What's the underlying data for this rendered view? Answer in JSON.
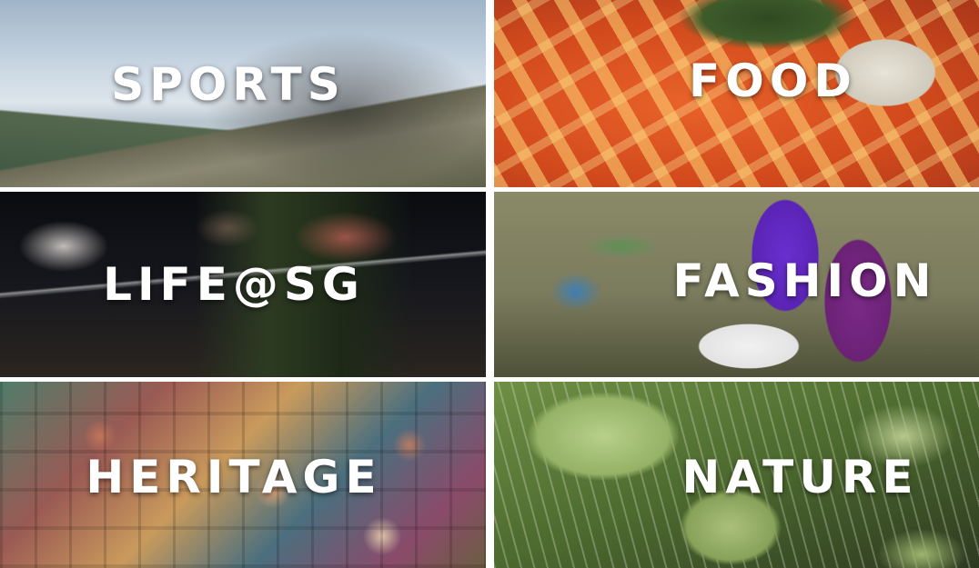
{
  "tiles": [
    {
      "id": "sports",
      "label": "SPORTS"
    },
    {
      "id": "food",
      "label": "FOOD"
    },
    {
      "id": "life",
      "label": "LIFE@SG"
    },
    {
      "id": "fashion",
      "label": "FASHION"
    },
    {
      "id": "heritage",
      "label": "HERITAGE"
    },
    {
      "id": "nature",
      "label": "NATURE"
    }
  ],
  "colors": {
    "label_text": "#ffffff",
    "gutter": "#ffffff"
  }
}
